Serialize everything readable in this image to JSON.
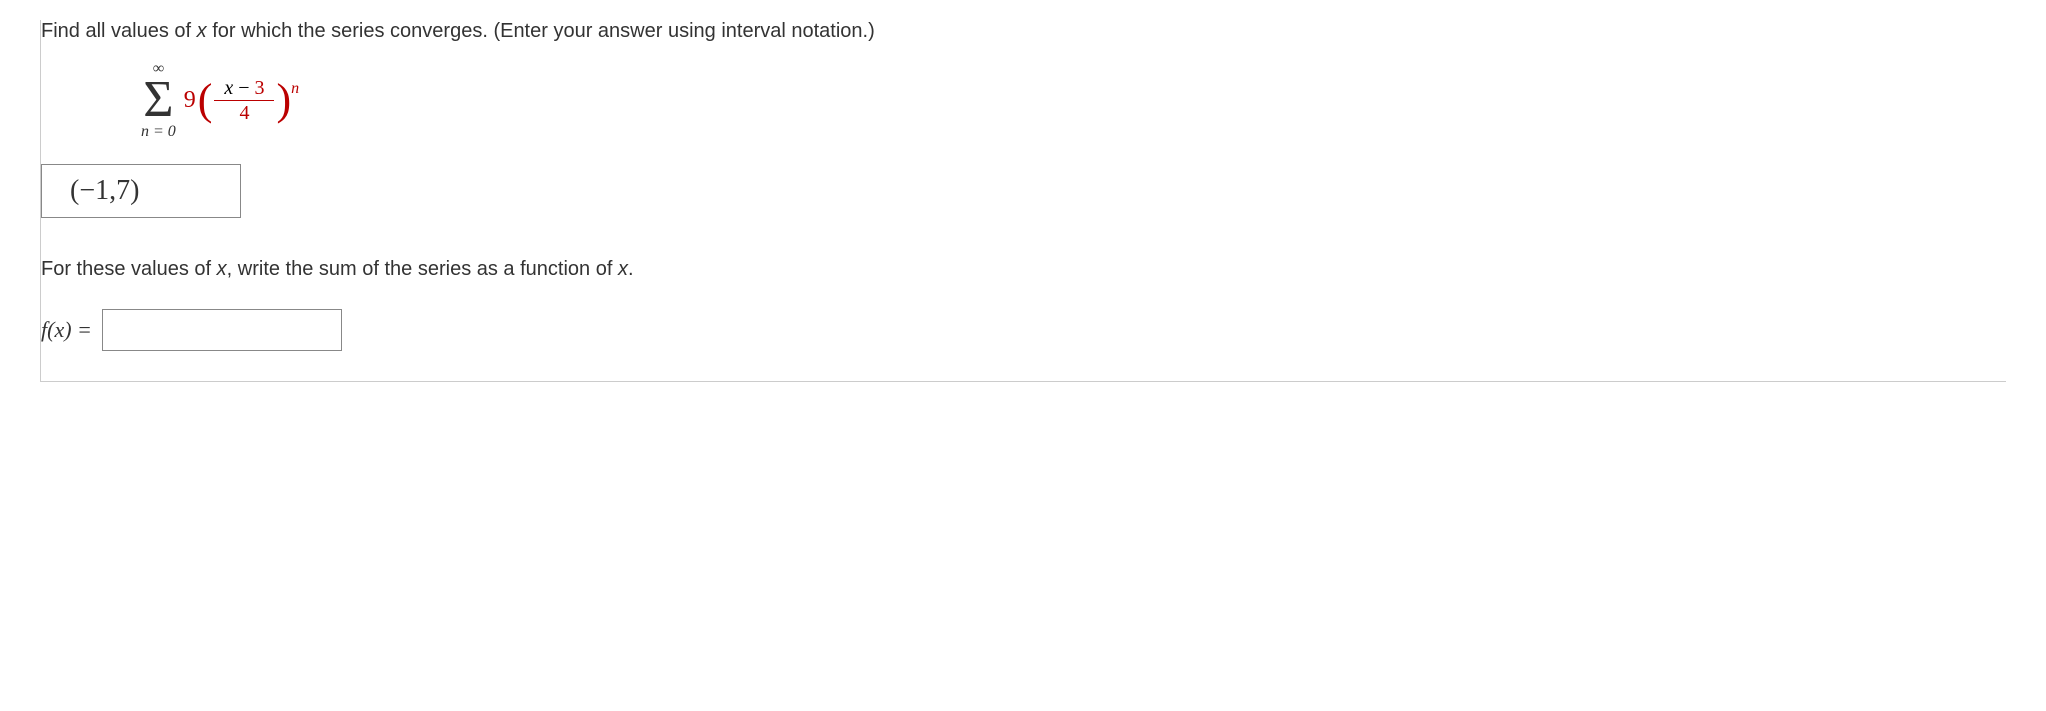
{
  "prompt1_pre": "Find all values of ",
  "prompt1_var": "x",
  "prompt1_post": " for which the series converges. (Enter your answer using interval notation.)",
  "series": {
    "upper": "∞",
    "lower": "n = 0",
    "coef": "9",
    "numerator_var": "x",
    "numerator_minus": "−",
    "numerator_const": "3",
    "denominator": "4",
    "exponent": "n"
  },
  "answer1": "(−1,7)",
  "prompt2_pre": "For these values of ",
  "prompt2_var": "x",
  "prompt2_mid": ", write the sum of the series as a function of ",
  "prompt2_var2": "x",
  "prompt2_post": ".",
  "fx_label_f": "f",
  "fx_label_x": "x",
  "fx_label_eq": " = ",
  "fx_value": ""
}
